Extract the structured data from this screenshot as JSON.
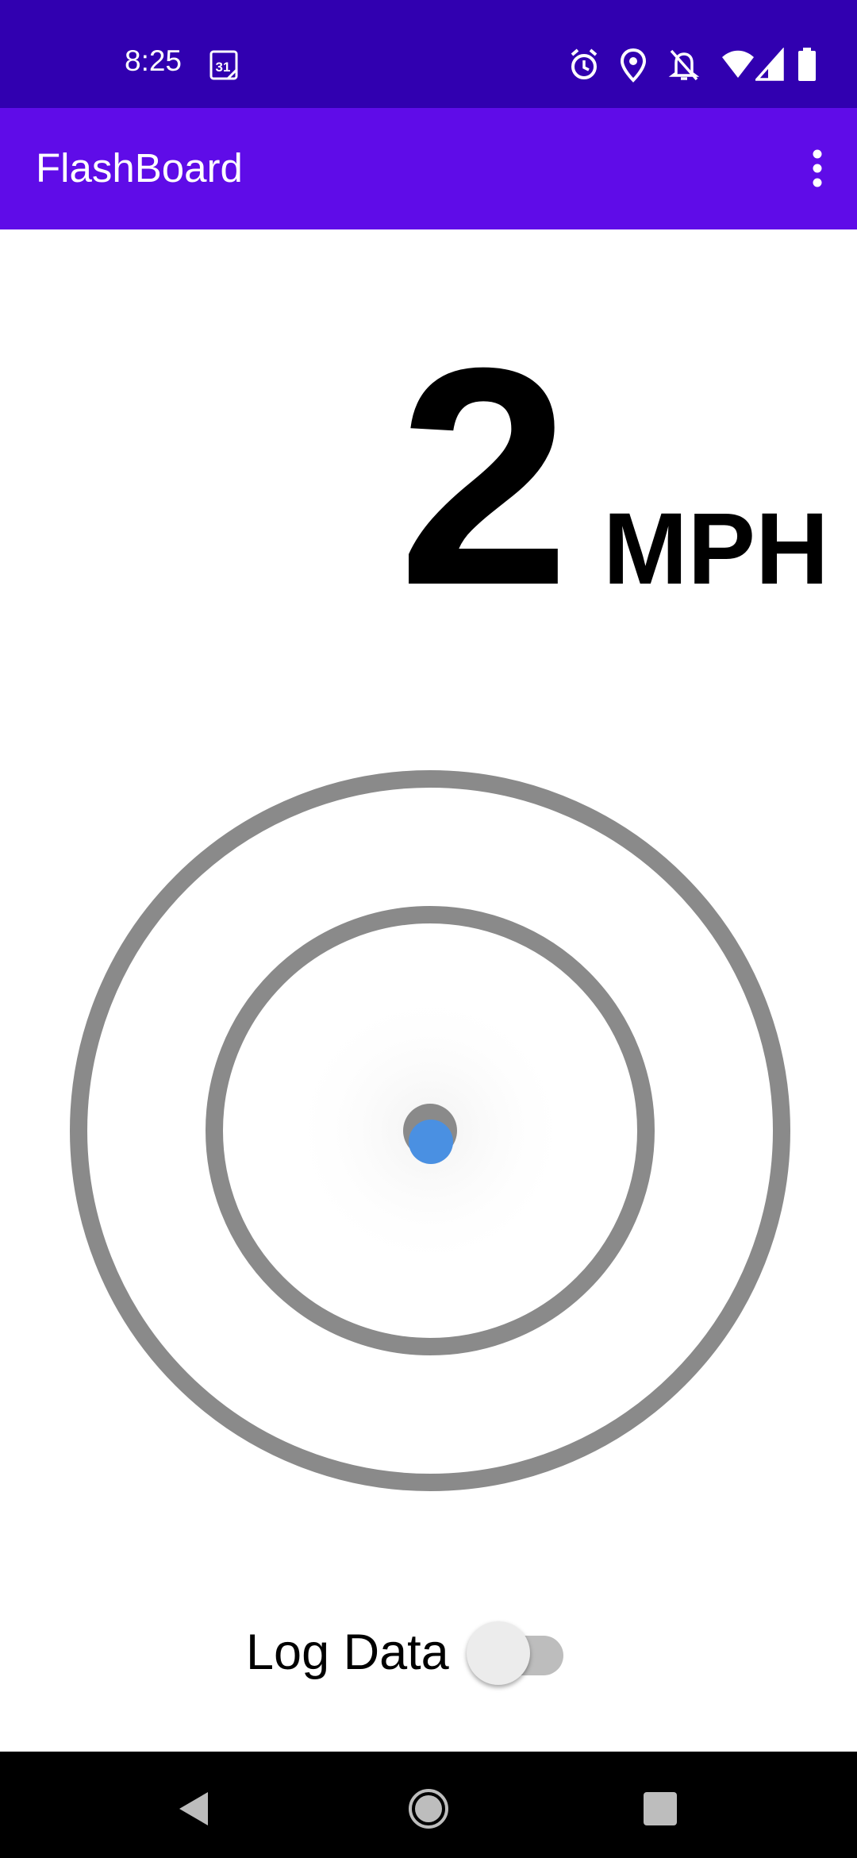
{
  "status_bar": {
    "time": "8:25",
    "calendar_date": "31",
    "icons": [
      "calendar-icon",
      "alarm-icon",
      "location-icon",
      "notifications-off-icon",
      "wifi-icon",
      "signal-icon",
      "battery-icon"
    ],
    "background": "#3100b0"
  },
  "app_bar": {
    "title": "FlashBoard",
    "background": "#5f0ce8",
    "menu_icon": "more-vert-icon"
  },
  "speed": {
    "value": "2",
    "unit": "MPH"
  },
  "target": {
    "ring_color": "#8a8a8a",
    "dot_color": "#4a90e2"
  },
  "log": {
    "label": "Log Data",
    "enabled": false
  },
  "nav_bar": {
    "icons": [
      "back-icon",
      "home-icon",
      "recents-icon"
    ]
  }
}
